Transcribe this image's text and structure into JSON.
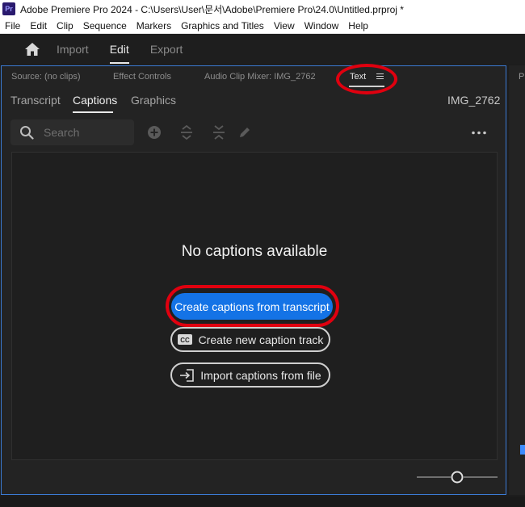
{
  "window": {
    "app_logo": "Pr",
    "title": "Adobe Premiere Pro 2024 - C:\\Users\\User\\문서\\Adobe\\Premiere Pro\\24.0\\Untitled.prproj *"
  },
  "menubar": {
    "items": [
      "File",
      "Edit",
      "Clip",
      "Sequence",
      "Markers",
      "Graphics and Titles",
      "View",
      "Window",
      "Help"
    ]
  },
  "workspace": {
    "home_icon": "home-icon",
    "tabs": [
      {
        "label": "Import",
        "active": false
      },
      {
        "label": "Edit",
        "active": true
      },
      {
        "label": "Export",
        "active": false
      }
    ]
  },
  "panel": {
    "tabs": [
      {
        "label": "Source: (no clips)",
        "active": false
      },
      {
        "label": "Effect Controls",
        "active": false
      },
      {
        "label": "Audio Clip Mixer: IMG_2762",
        "active": false
      },
      {
        "label": "Text",
        "active": true
      }
    ],
    "menu_icon": "panel-menu-icon",
    "subtabs": [
      {
        "label": "Transcript",
        "active": false
      },
      {
        "label": "Captions",
        "active": true
      },
      {
        "label": "Graphics",
        "active": false
      }
    ],
    "clip_name": "IMG_2762",
    "search": {
      "placeholder": "Search",
      "value": ""
    },
    "toolbar_icons": [
      "add-icon",
      "merge-icon",
      "split-icon",
      "pencil-icon",
      "more-icon"
    ],
    "empty_state": {
      "title": "No captions available",
      "primary_button": "Create captions from transcript",
      "new_track_button": "Create new caption track",
      "new_track_icon": "cc-icon",
      "import_button": "Import captions from file",
      "import_icon": "import-icon"
    }
  },
  "right_panel": {
    "edge_letter": "P"
  },
  "colors": {
    "accent": "#1473e6",
    "panel_border": "#3b7bd4",
    "annotation": "#e0000f"
  }
}
